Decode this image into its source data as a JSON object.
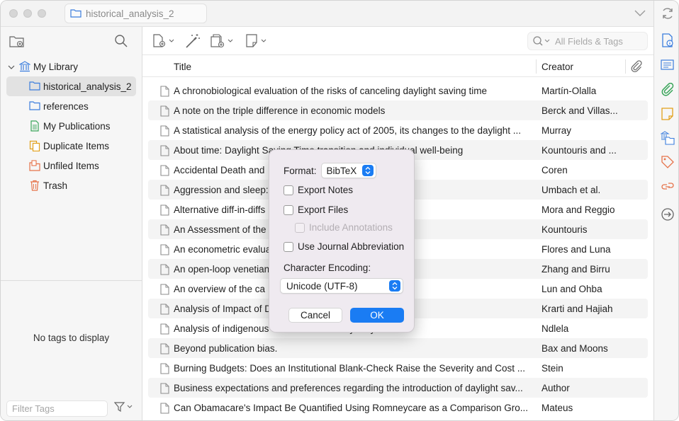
{
  "titlebar": {
    "tab_label": "historical_analysis_2"
  },
  "sidebar": {
    "items": [
      {
        "label": "My Library",
        "icon": "library-icon"
      },
      {
        "label": "historical_analysis_2",
        "icon": "folder-icon"
      },
      {
        "label": "references",
        "icon": "folder-icon"
      },
      {
        "label": "My Publications",
        "icon": "publications-icon"
      },
      {
        "label": "Duplicate Items",
        "icon": "duplicate-icon"
      },
      {
        "label": "Unfiled Items",
        "icon": "unfiled-icon"
      },
      {
        "label": "Trash",
        "icon": "trash-icon"
      }
    ],
    "no_tags_text": "No tags to display",
    "filter_placeholder": "Filter Tags"
  },
  "toolbar": {
    "search_placeholder": "All Fields & Tags"
  },
  "columns": {
    "title": "Title",
    "creator": "Creator"
  },
  "rows": [
    {
      "title": "A chronobiological evaluation of the risks of canceling daylight saving time",
      "creator": "Martín-Olalla"
    },
    {
      "title": "A note on the triple difference in economic models",
      "creator": "Berck and Villas..."
    },
    {
      "title": "A statistical analysis of the energy policy act of 2005, its changes to the daylight ...",
      "creator": "Murray"
    },
    {
      "title": "About time: Daylight Saving Time transition and individual well-being",
      "creator": "Kountouris and ..."
    },
    {
      "title": "Accidental Death and",
      "creator": "Coren"
    },
    {
      "title": "Aggression and sleep: ... eriment on the effect of ...",
      "creator": "Umbach et al."
    },
    {
      "title": "Alternative diff-in-diffs ... ment periods",
      "creator": "Mora and Reggio"
    },
    {
      "title": "An Assessment of the ... ving Time, Disruptions in ...",
      "creator": "Kountouris"
    },
    {
      "title": "An econometric evalua ... xico",
      "creator": "Flores and Luna"
    },
    {
      "title": "An open-loop venetian ... ght and enhance dayligh...",
      "creator": "Zhang and Birru"
    },
    {
      "title": "An overview of the ca ... g energy strategy after F...",
      "creator": "Lun and Ohba"
    },
    {
      "title": "Analysis of Impact of D ... se of Buildings in Kuwait",
      "creator": "Krarti and Hajiah"
    },
    {
      "title": "Analysis of indigenous ... ntial source of hydrolytic...",
      "creator": "Ndlela"
    },
    {
      "title": "Beyond publication bias.",
      "creator": "Bax and Moons"
    },
    {
      "title": "Burning Budgets: Does an Institutional Blank-Check Raise the Severity and Cost ...",
      "creator": "Stein"
    },
    {
      "title": "Business expectations and preferences regarding the introduction of daylight sav...",
      "creator": "Author"
    },
    {
      "title": "Can Obamacare's Impact Be Quantified Using Romneycare as a Comparison Gro...",
      "creator": "Mateus"
    }
  ],
  "dialog": {
    "format_label": "Format:",
    "format_value": "BibTeX",
    "export_notes": "Export Notes",
    "export_files": "Export Files",
    "include_annotations": "Include Annotations",
    "journal_abbrev": "Use Journal Abbreviation",
    "encoding_label": "Character Encoding:",
    "encoding_value": "Unicode (UTF-8)",
    "cancel": "Cancel",
    "ok": "OK"
  },
  "colors": {
    "accent": "#1a7cf3",
    "sidebar_bg": "#f6f6f6",
    "selected_bg": "#e2e2e2"
  }
}
